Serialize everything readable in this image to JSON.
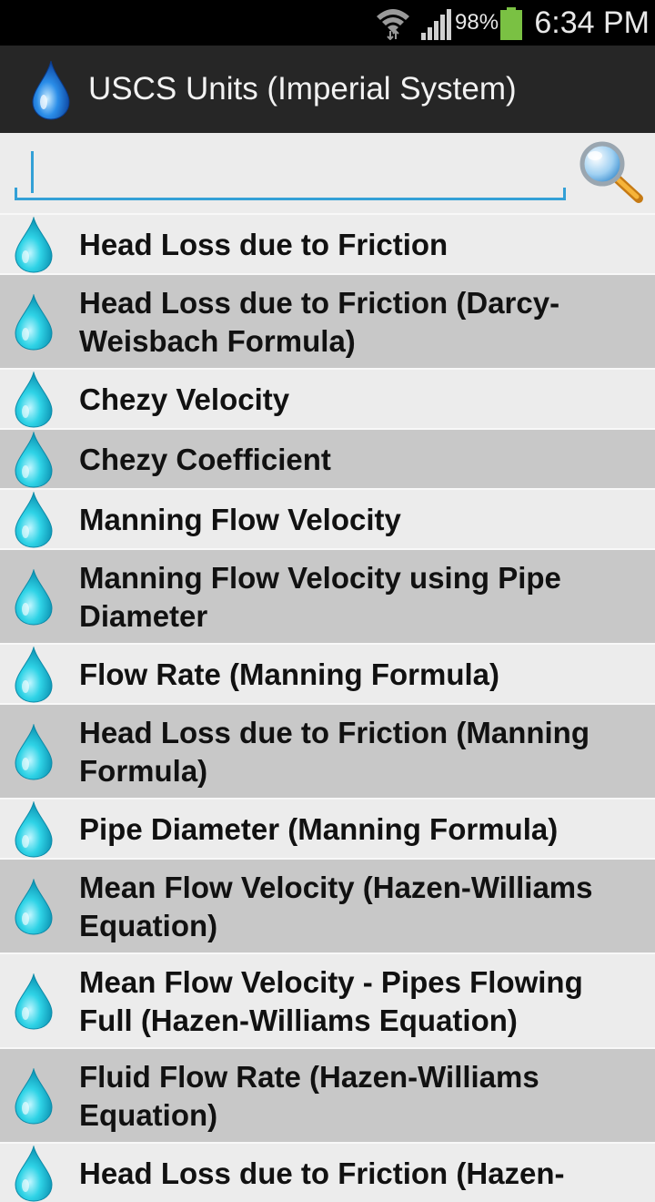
{
  "status_bar": {
    "time": "6:34 PM",
    "battery_percent": "98%",
    "battery_level": 0.98,
    "icons": [
      "wifi-icon",
      "signal-icon",
      "battery-icon"
    ]
  },
  "action_bar": {
    "title": "USCS Units (Imperial System)",
    "app_icon": "water-drop-icon"
  },
  "search": {
    "value": "",
    "placeholder": "",
    "button_icon": "magnifier-icon"
  },
  "colors": {
    "accent": "#33a0d6",
    "row_light": "#ececec",
    "row_dark": "#c8c8c8",
    "action_bar": "#262626",
    "drop": "#1cc4d8"
  },
  "items": [
    {
      "label": "Head Loss due to Friction"
    },
    {
      "label": "Head Loss due to Friction (Darcy-Weisbach Formula)"
    },
    {
      "label": "Chezy Velocity"
    },
    {
      "label": "Chezy Coefficient"
    },
    {
      "label": "Manning Flow Velocity"
    },
    {
      "label": "Manning Flow Velocity using Pipe Diameter"
    },
    {
      "label": "Flow Rate (Manning Formula)"
    },
    {
      "label": "Head Loss due to Friction (Manning Formula)"
    },
    {
      "label": "Pipe Diameter (Manning Formula)"
    },
    {
      "label": "Mean Flow Velocity (Hazen-Williams Equation)"
    },
    {
      "label": "Mean Flow Velocity - Pipes Flowing Full (Hazen-Williams Equation)"
    },
    {
      "label": "Fluid Flow Rate (Hazen-Williams Equation)"
    },
    {
      "label": "Head Loss due to Friction (Hazen-"
    }
  ]
}
